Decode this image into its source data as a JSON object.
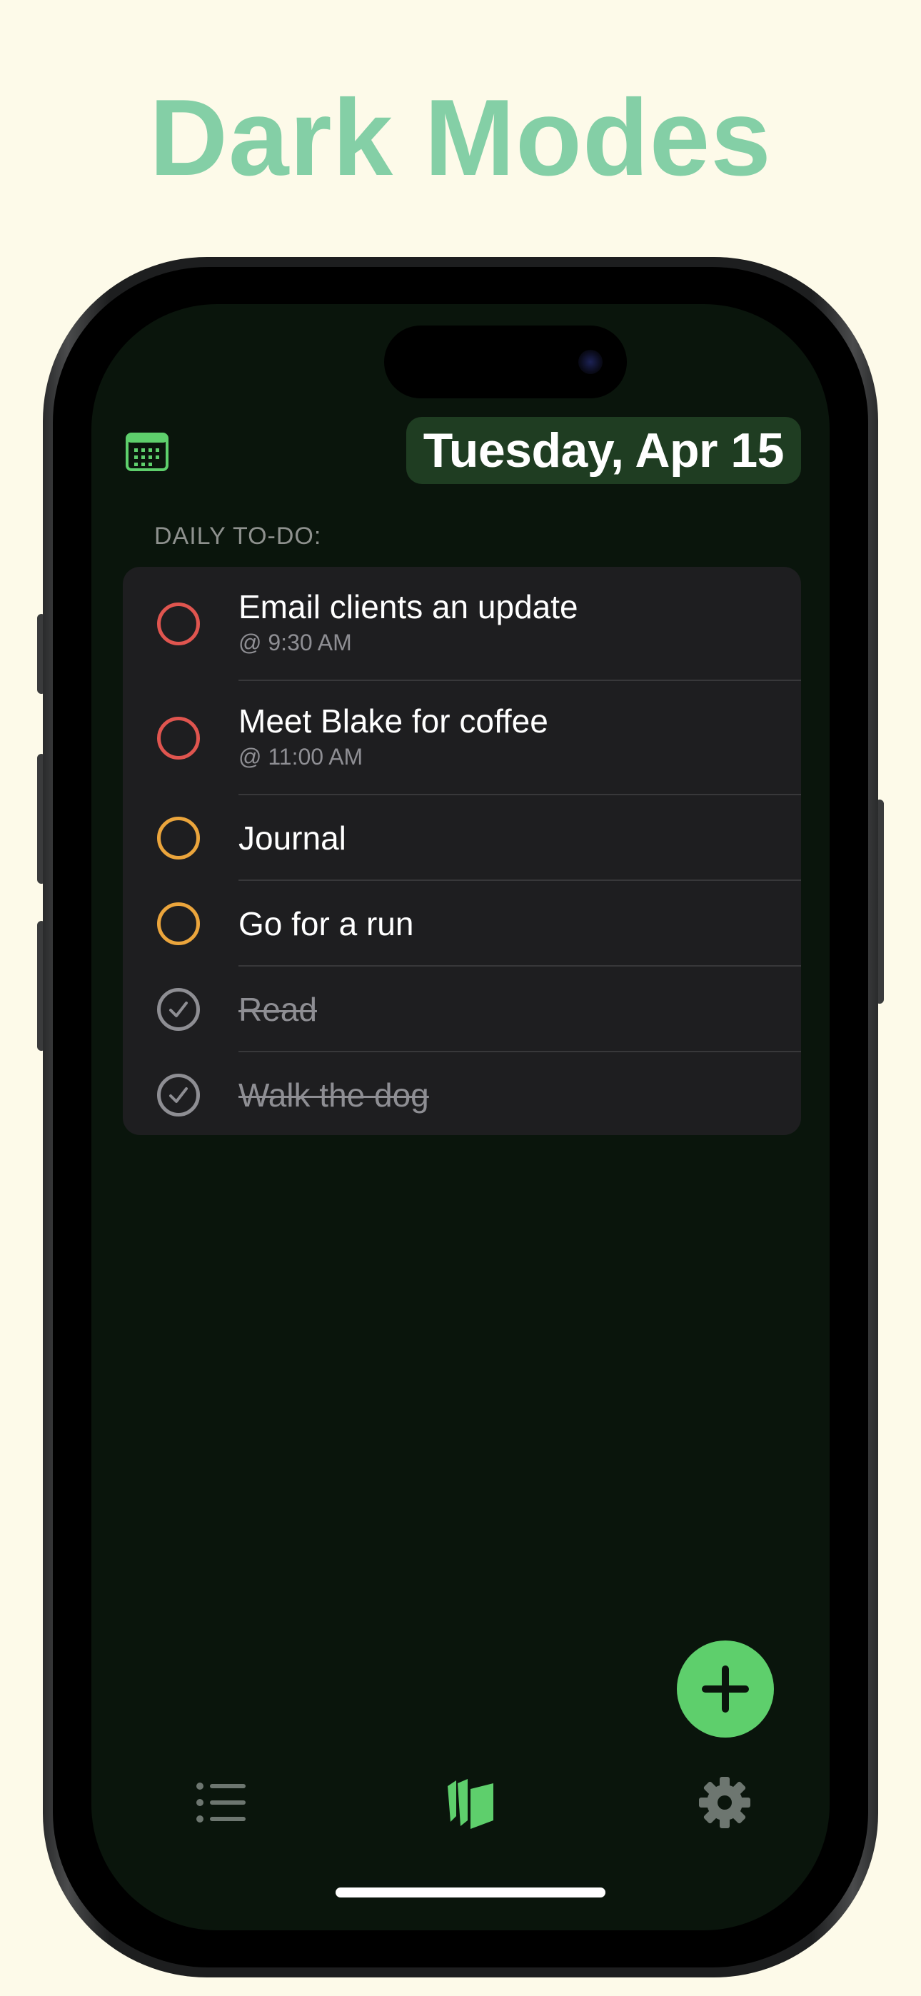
{
  "headline": "Dark Modes",
  "header": {
    "date_label": "Tuesday, Apr 15"
  },
  "section_label": "DAILY TO-DO:",
  "tasks": [
    {
      "title": "Email clients an update",
      "time": "@ 9:30 AM",
      "ring_color": "#e0554f",
      "done": false
    },
    {
      "title": "Meet Blake for coffee",
      "time": "@ 11:00 AM",
      "ring_color": "#e0554f",
      "done": false
    },
    {
      "title": "Journal",
      "time": "",
      "ring_color": "#eba53c",
      "done": false
    },
    {
      "title": "Go for a run",
      "time": "",
      "ring_color": "#eba53c",
      "done": false
    },
    {
      "title": "Read",
      "time": "",
      "ring_color": "#8e8e93",
      "done": true
    },
    {
      "title": "Walk the dog",
      "time": "",
      "ring_color": "#8e8e93",
      "done": true
    }
  ],
  "tabs": [
    {
      "icon": "list-icon",
      "active": false
    },
    {
      "icon": "cards-icon",
      "active": true
    },
    {
      "icon": "gear-icon",
      "active": false
    }
  ],
  "colors": {
    "accent": "#5ecf6c",
    "headline": "#84cfa6",
    "date_pill_bg": "#1f3d22",
    "screen_bg": "#0a150c",
    "card_bg": "#1e1e20"
  }
}
